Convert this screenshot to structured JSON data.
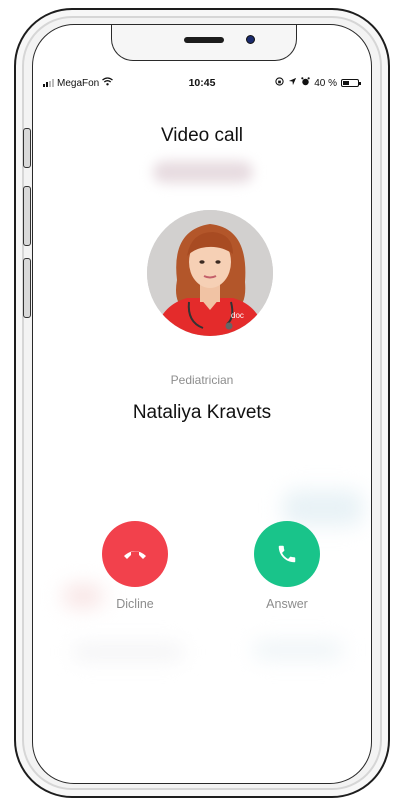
{
  "status_bar": {
    "carrier": "MegaFon",
    "time": "10:45",
    "battery_text": "40 %",
    "battery_level": 0.4
  },
  "call": {
    "title": "Video call",
    "specialty": "Pediatrician",
    "doctor_name": "Nataliya Kravets",
    "shirt_logo": "doc"
  },
  "actions": {
    "decline_label": "Dicline",
    "answer_label": "Answer"
  },
  "colors": {
    "decline": "#f2414c",
    "answer": "#19c48a",
    "text_primary": "#111111",
    "text_secondary": "#8c8c8c"
  },
  "icons": {
    "decline": "phone-hangup-icon",
    "answer": "phone-icon",
    "wifi": "wifi-icon",
    "location": "location-arrow-icon",
    "alarm": "alarm-icon",
    "rotation_lock": "rotation-lock-icon",
    "battery": "battery-icon"
  }
}
